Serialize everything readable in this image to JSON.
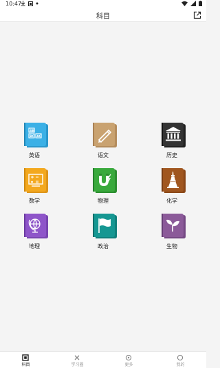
{
  "status_bar": {
    "time": "10:47"
  },
  "header": {
    "title": "科目",
    "share_icon": "share-icon"
  },
  "subjects": [
    {
      "label": "英语",
      "icon": "english-abc-icon",
      "color": "#3bb0e6"
    },
    {
      "label": "语文",
      "icon": "pencil-icon",
      "color": "#c9a270"
    },
    {
      "label": "历史",
      "icon": "museum-icon",
      "color": "#333333"
    },
    {
      "label": "数学",
      "icon": "calculator-icon",
      "color": "#f3a81e"
    },
    {
      "label": "物理",
      "icon": "magnet-icon",
      "color": "#39a93c"
    },
    {
      "label": "化学",
      "icon": "flask-tower-icon",
      "color": "#a0561f"
    },
    {
      "label": "地理",
      "icon": "globe-icon",
      "color": "#8e55c9"
    },
    {
      "label": "政治",
      "icon": "flag-icon",
      "color": "#159792"
    },
    {
      "label": "生物",
      "icon": "sprout-icon",
      "color": "#8b5a99"
    }
  ],
  "tabs": [
    {
      "label": "科目",
      "icon": "grid-icon",
      "active": true
    },
    {
      "label": "学习圈",
      "icon": "close-x-icon",
      "active": false
    },
    {
      "label": "更多",
      "icon": "more-icon",
      "active": false
    },
    {
      "label": "我的",
      "icon": "profile-icon",
      "active": false
    }
  ]
}
